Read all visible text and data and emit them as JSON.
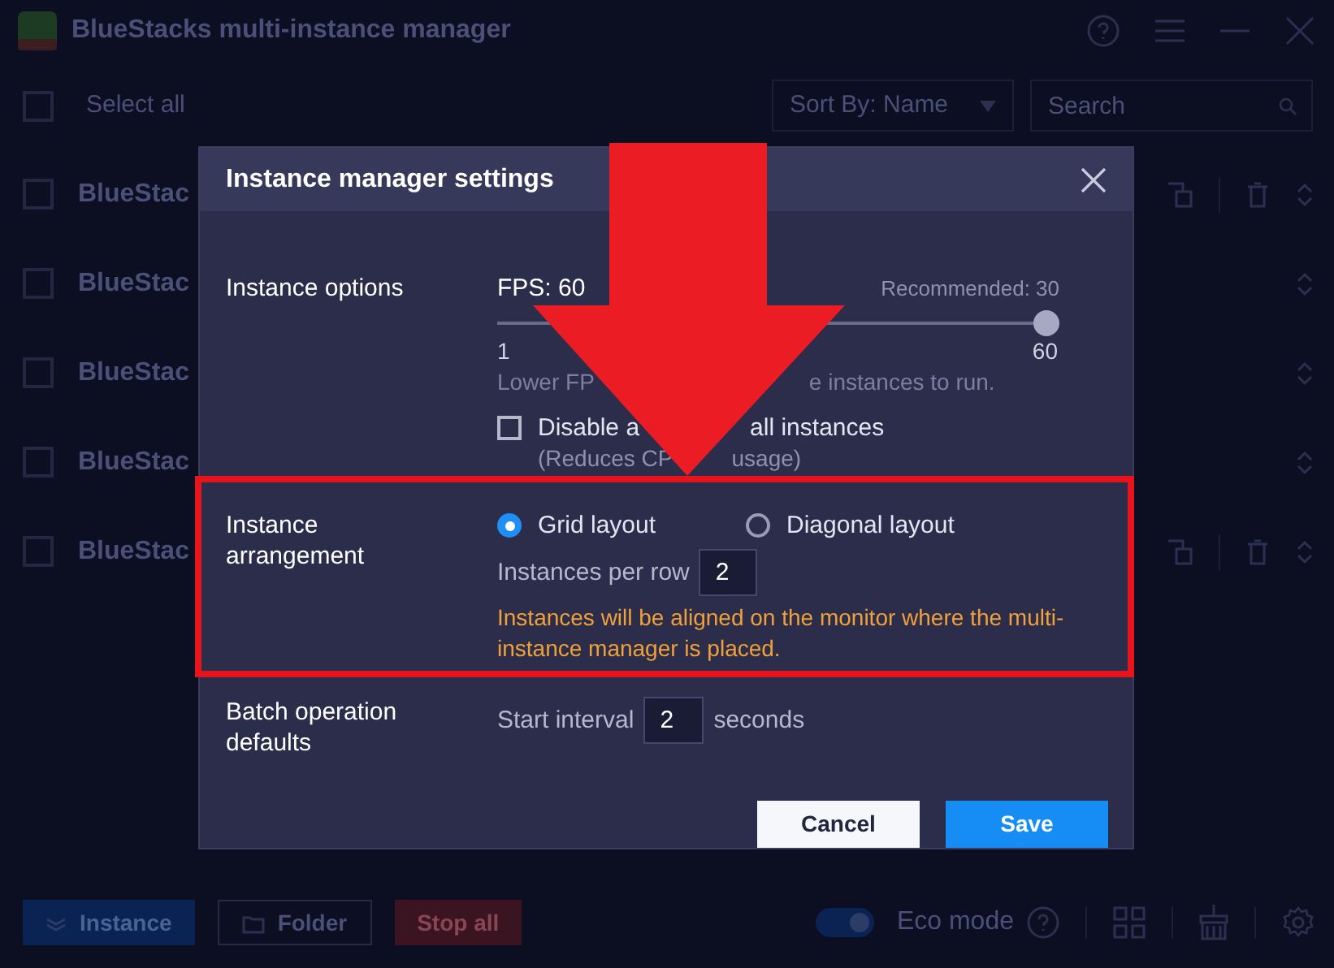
{
  "app": {
    "title": "BlueStacks multi-instance manager",
    "select_all": "Select all",
    "select_all_checked": false,
    "sort": "Sort By: Name",
    "search_placeholder": "Search"
  },
  "instances": [
    {
      "name": "BlueStac",
      "checked": false,
      "actions_visible": true
    },
    {
      "name": "BlueStac",
      "checked": false,
      "actions_visible": false
    },
    {
      "name": "BlueStac",
      "checked": false,
      "actions_visible": false
    },
    {
      "name": "BlueStac",
      "checked": false,
      "actions_visible": false
    },
    {
      "name": "BlueStac",
      "checked": false,
      "actions_visible": true
    }
  ],
  "footer": {
    "buttons": [
      {
        "label": "Instance",
        "kind": "primary"
      },
      {
        "label": "Folder",
        "kind": "outline"
      },
      {
        "label": "Stop all",
        "kind": "danger"
      }
    ],
    "eco_mode": {
      "label": "Eco mode",
      "on": true
    }
  },
  "dialog": {
    "title": "Instance manager settings",
    "instance_options": {
      "label": "Instance options",
      "fps_label": "FPS: 60",
      "recommended": "Recommended: 30",
      "level": 1,
      "min": "1",
      "max": "60",
      "hint": [
        "Lower FP",
        "e instances to run."
      ],
      "disable_audio": {
        "checked": false,
        "text": [
          "Disable a",
          "all instances"
        ],
        "note": [
          "(Reduces CP",
          "usage)"
        ]
      }
    },
    "arrangement": {
      "label": "Instance arrangement",
      "options": [
        {
          "label": "Grid layout",
          "selected": true
        },
        {
          "label": "Diagonal layout",
          "selected": false
        }
      ],
      "per_row_label": "Instances per row",
      "per_row": "2",
      "note": "Instances will be aligned on the monitor where the multi-instance manager is placed."
    },
    "batch": {
      "label": "Batch operation defaults",
      "interval_label": "Start interval",
      "interval": "2",
      "unit": "seconds"
    },
    "buttons": [
      {
        "label": "Cancel",
        "kind": "secondary"
      },
      {
        "label": "Save",
        "kind": "primary"
      }
    ]
  }
}
